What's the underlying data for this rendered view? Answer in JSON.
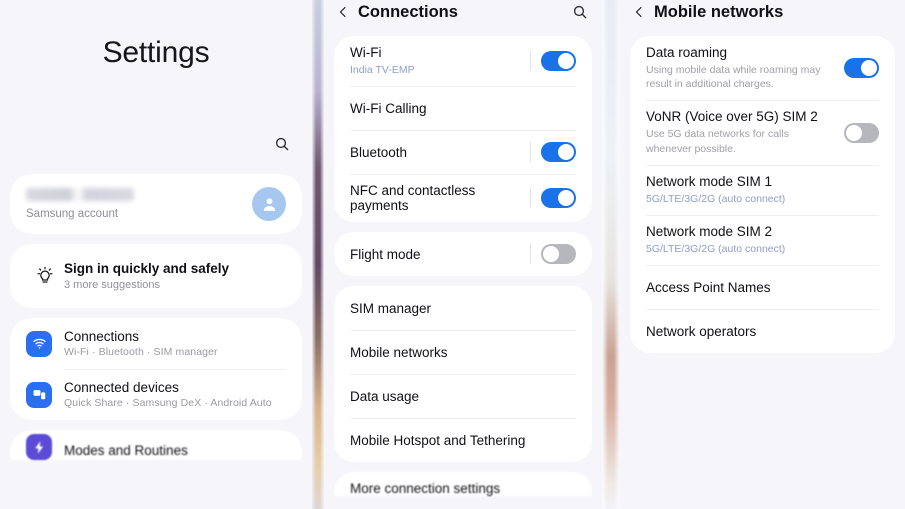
{
  "left_panel": {
    "title": "Settings",
    "search_icon": "search-icon",
    "account": {
      "name_redacted": "",
      "subtitle": "Samsung account",
      "avatar_icon": "person-icon"
    },
    "suggestion": {
      "icon": "lightbulb-icon",
      "title": "Sign in quickly and safely",
      "subtitle": "3 more suggestions"
    },
    "menu": [
      {
        "icon": "wifi-icon",
        "icon_color": "#2a6ff0",
        "title": "Connections",
        "subtitle": "Wi-Fi  ·  Bluetooth  ·  SIM manager"
      },
      {
        "icon": "devices-icon",
        "icon_color": "#2a6ff0",
        "title": "Connected devices",
        "subtitle": "Quick Share  ·  Samsung DeX  ·  Android Auto"
      }
    ],
    "menu_cut": [
      {
        "icon": "modes-icon",
        "icon_color": "#5b4bd6",
        "title": "Modes and Routines",
        "subtitle": ""
      }
    ]
  },
  "mid_panel": {
    "header": {
      "back_icon": "chevron-left-icon",
      "title": "Connections",
      "search_icon": "search-icon"
    },
    "group_1": [
      {
        "title": "Wi-Fi",
        "subtitle": "India TV-EMP",
        "subtitle_style": "blue",
        "toggle": "on"
      },
      {
        "title": "Wi-Fi Calling",
        "subtitle": "",
        "toggle": "none"
      },
      {
        "title": "Bluetooth",
        "subtitle": "",
        "toggle": "on"
      },
      {
        "title": "NFC and contactless payments",
        "subtitle": "",
        "toggle": "on"
      }
    ],
    "group_2": [
      {
        "title": "Flight mode",
        "subtitle": "",
        "toggle": "off"
      }
    ],
    "group_3": [
      {
        "title": "SIM manager",
        "subtitle": "",
        "toggle": "none"
      },
      {
        "title": "Mobile networks",
        "subtitle": "",
        "toggle": "none"
      },
      {
        "title": "Data usage",
        "subtitle": "",
        "toggle": "none"
      },
      {
        "title": "Mobile Hotspot and Tethering",
        "subtitle": "",
        "toggle": "none"
      }
    ],
    "group_4": [
      {
        "title": "More connection settings",
        "subtitle": "",
        "toggle": "none"
      }
    ]
  },
  "right_panel": {
    "header": {
      "back_icon": "chevron-left-icon",
      "title": "Mobile networks"
    },
    "group_1": [
      {
        "title": "Data roaming",
        "subtitle": "Using mobile data while roaming may result in additional charges.",
        "subtitle_style": "gray",
        "toggle": "on"
      },
      {
        "title": "VoNR (Voice over 5G) SIM 2",
        "subtitle": "Use 5G data networks for calls whenever possible.",
        "subtitle_style": "gray",
        "toggle": "off"
      },
      {
        "title": "Network mode SIM 1",
        "subtitle": "5G/LTE/3G/2G (auto connect)",
        "subtitle_style": "blue",
        "toggle": "none"
      },
      {
        "title": "Network mode SIM 2",
        "subtitle": "5G/LTE/3G/2G (auto connect)",
        "subtitle_style": "blue",
        "toggle": "none"
      },
      {
        "title": "Access Point Names",
        "subtitle": "",
        "toggle": "none"
      },
      {
        "title": "Network operators",
        "subtitle": "",
        "toggle": "none"
      }
    ]
  },
  "colors": {
    "accent_blue": "#1a72e8",
    "toggle_off": "#b6b6bd",
    "background": "#f5f5fa",
    "card": "#ffffff",
    "text_primary": "#101015",
    "text_secondary": "#9a9aa2",
    "link_blue": "#8e9ec6",
    "icon_blue": "#2a6ff0",
    "icon_purple": "#5b4bd6",
    "avatar_blue": "#a6c8f0"
  }
}
